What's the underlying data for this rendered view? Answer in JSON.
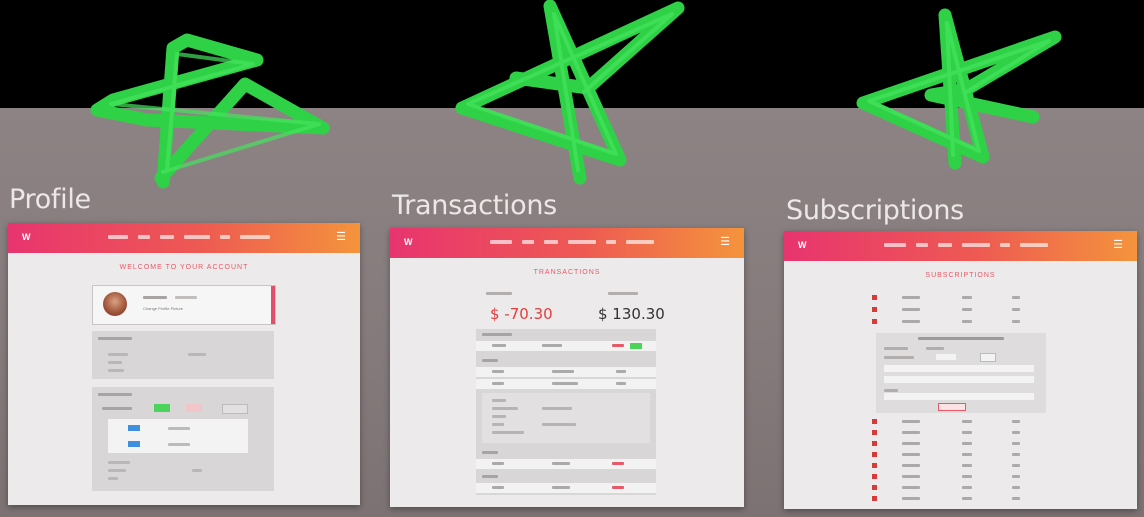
{
  "sections": [
    {
      "title": "Profile",
      "board_heading": "WELCOME TO YOUR ACCOUNT",
      "profile_link": "Change Profile Picture"
    },
    {
      "title": "Transactions",
      "board_heading": "TRANSACTIONS",
      "amount_left": "$ -70.30",
      "amount_right": "$ 130.30"
    },
    {
      "title": "Subscriptions",
      "board_heading": "SUBSCRIPTIONS"
    }
  ],
  "board_logo": "W",
  "menu_icon": "hamburger-icon",
  "annotations": [
    "star-drawing",
    "star-drawing",
    "star-drawing"
  ],
  "colors": {
    "navbar_start": "#e8346f",
    "navbar_end": "#f4943c",
    "star_green": "#2fd246",
    "negative_amount": "#e53c3c",
    "positive_amount": "#333333",
    "wall": "#857b7c"
  }
}
